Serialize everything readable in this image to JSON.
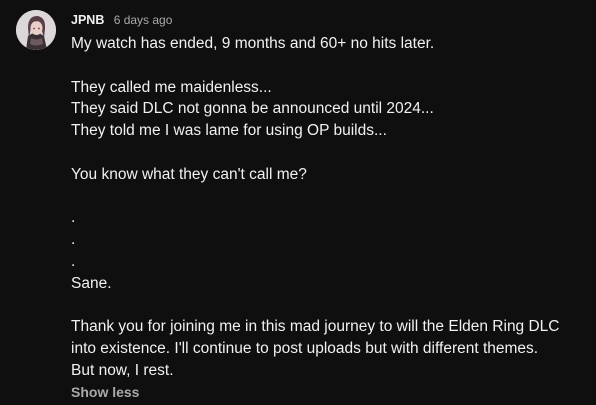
{
  "comment": {
    "author": "JPNB",
    "timestamp": "6 days ago",
    "avatar_icon": "anime-character-avatar",
    "lines": [
      "My watch has ended, 9 months and 60+ no hits later.",
      "",
      "They called me maidenless...",
      "They said DLC not gonna be announced until 2024...",
      "They told me I was lame for using OP builds...",
      "",
      "You know what they can't call me?",
      "",
      ".",
      ".",
      ".",
      "Sane.",
      "",
      "Thank you for joining me in this mad journey to will the Elden Ring DLC",
      "into existence. I'll continue to post uploads but with different themes.",
      "But now, I rest."
    ],
    "show_less_label": "Show less"
  },
  "colors": {
    "background": "#0f0f0f",
    "text": "#f1f1f1",
    "secondary_text": "#aaaaaa"
  }
}
